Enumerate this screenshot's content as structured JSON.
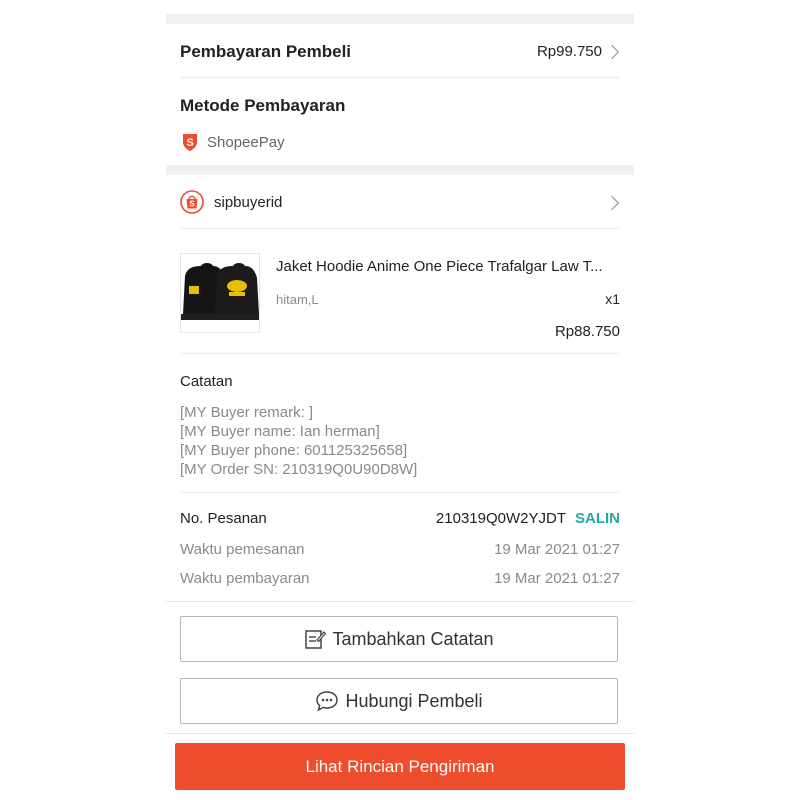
{
  "payment": {
    "label": "Pembayaran Pembeli",
    "amount": "Rp99.750"
  },
  "method": {
    "title": "Metode Pembayaran",
    "name": "ShopeePay",
    "icon": "shopeepay-icon",
    "icon_color": "#ee4d2d"
  },
  "buyer": {
    "name": "sipbuyerid",
    "icon": "shopee-bag-icon"
  },
  "product": {
    "title": "Jaket Hoodie Anime One Piece Trafalgar Law T...",
    "variant": "hitam,L",
    "qty": "x1",
    "price": "Rp88.750",
    "image": "black-hoodie-thumbnail"
  },
  "notes": {
    "title": "Catatan",
    "lines": [
      "[MY Buyer remark: ]",
      "[MY Buyer name: Ian herman]",
      "[MY Buyer phone: 601125325658]",
      "[MY Order SN: 210319Q0U90D8W]"
    ]
  },
  "order": {
    "no_label": "No. Pesanan",
    "no_value": "210319Q0W2YJDT",
    "copy_label": "SALIN",
    "copy_color": "#26aa99",
    "order_time_label": "Waktu pemesanan",
    "order_time_value": "19 Mar 2021 01:27",
    "pay_time_label": "Waktu pembayaran",
    "pay_time_value": "19 Mar 2021 01:27"
  },
  "actions": {
    "add_note": "Tambahkan Catatan",
    "add_note_icon": "edit-note-icon",
    "contact": "Hubungi Pembeli",
    "contact_icon": "chat-bubble-icon",
    "shipping": "Lihat Rincian Pengiriman"
  },
  "colors": {
    "accent": "#ee4d2d",
    "teal": "#26aa99"
  }
}
